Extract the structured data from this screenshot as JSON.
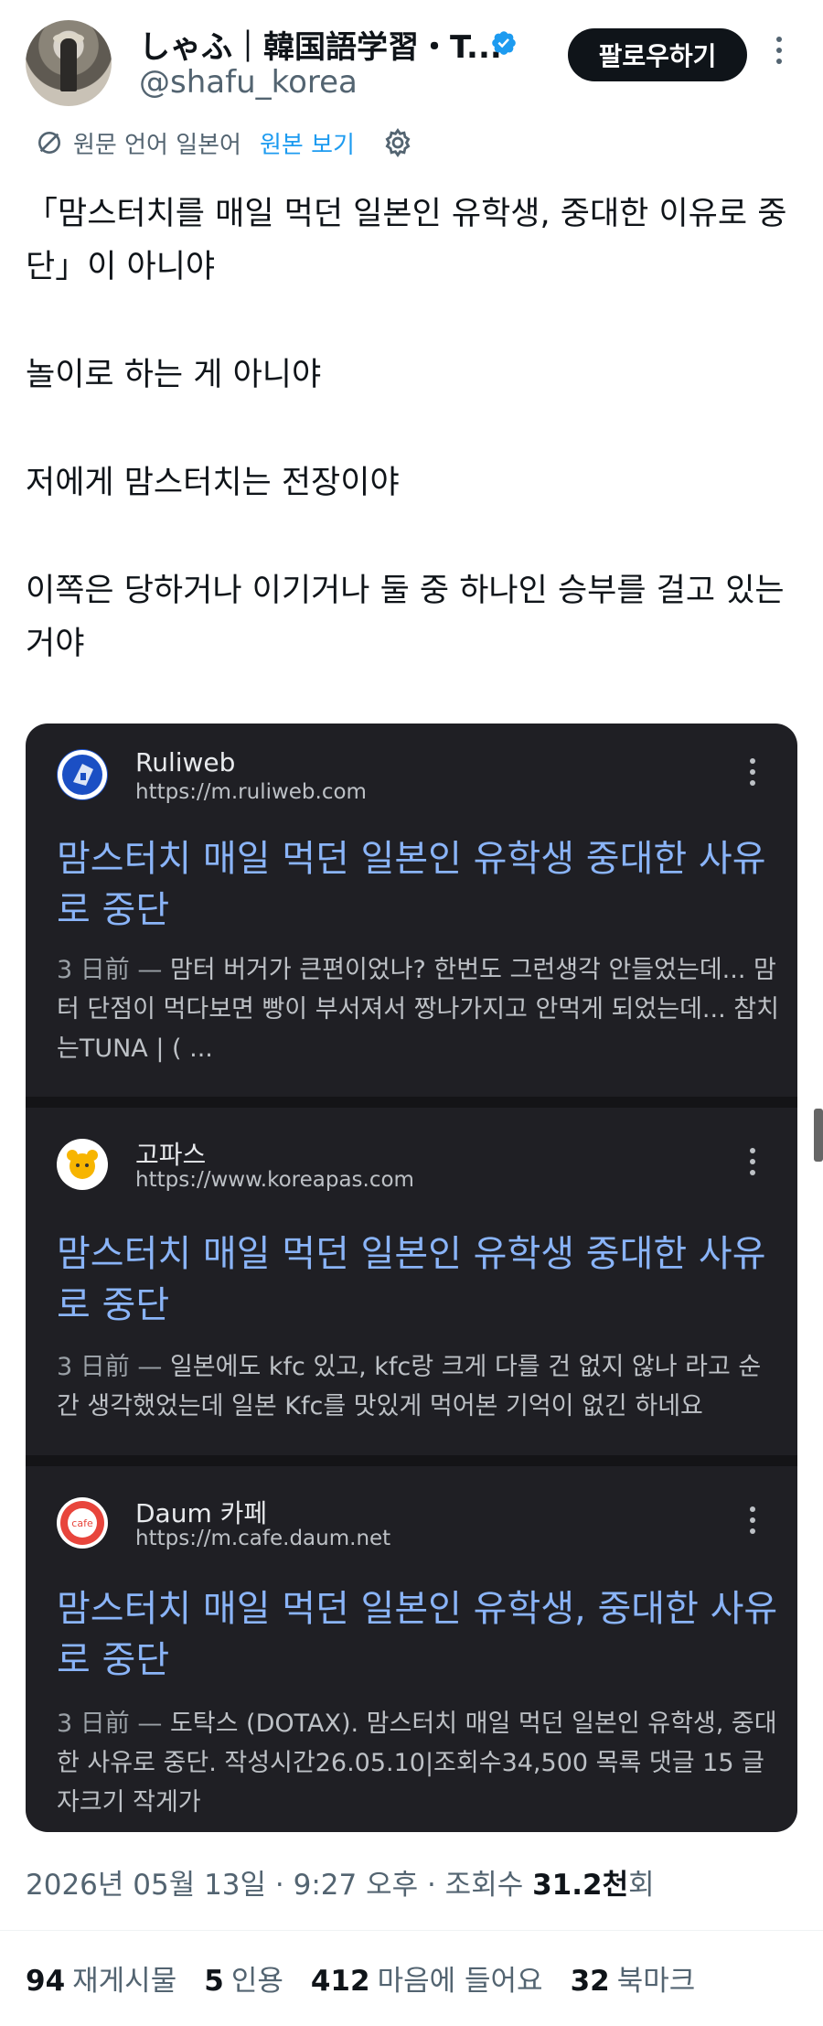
{
  "author": {
    "name": "しゃふ｜韓国語学習・T...",
    "handle": "@shafu_korea",
    "follow_label": "팔로우하기"
  },
  "translation": {
    "original_language": "원문 언어 일본어",
    "show_original": "원본 보기"
  },
  "tweet": {
    "lines": [
      "「맘스터치를 매일 먹던 일본인 유학생, 중대한 이유로 중단」이 아니야",
      "놀이로 하는 게 아니야",
      "저에게 맘스터치는 전장이야",
      "이쪽은 당하거나 이기거나 둘 중 하나인 승부를 걸고 있는 거야"
    ]
  },
  "results": [
    {
      "site": "Ruliweb",
      "url": "https://m.ruliweb.com",
      "title": "맘스터치 매일 먹던 일본인 유학생 중대한 사유로 중단",
      "date": "3 日前 — ",
      "snippet": "맘터 버거가 큰편이었나? 한번도 그런생각 안들었는데... 맘터 단점이 먹다보면 빵이 부서져서 짱나가지고 안먹게 되었는데... 참치는TUNA | ( ...",
      "logo_color": "#1b4fc4"
    },
    {
      "site": "고파스",
      "url": "https://www.koreapas.com",
      "title": "맘스터치 매일 먹던 일본인 유학생 중대한 사유로 중단",
      "date": "3 日前 — ",
      "snippet": "일본에도 kfc 있고, kfc랑 크게 다를 건 없지 않나 라고 순간 생각했었는데 일본 Kfc를 맛있게 먹어본 기억이 없긴 하네요",
      "logo_color": "#f7b500"
    },
    {
      "site": "Daum 카페",
      "url": "https://m.cafe.daum.net",
      "title": "맘스터치 매일 먹던 일본인 유학생, 중대한 사유로 중단",
      "date": "3 日前 — ",
      "snippet": "도탁스 (DOTAX). 맘스터치 매일 먹던 일본인 유학생, 중대한 사유로 중단. 작성시간26.05.10|조회수34,500 목록 댓글 15 글자크기 작게가",
      "logo_color": "#e8453c",
      "logo_text": "cafe"
    }
  ],
  "meta": {
    "timestamp": "2026년 05월 13일 · 9:27 오후 · 조회수 ",
    "views": "31.2천",
    "views_suffix": "회"
  },
  "stats": [
    {
      "count": "94",
      "label": "재게시물"
    },
    {
      "count": "5",
      "label": "인용"
    },
    {
      "count": "412",
      "label": "마음에 들어요"
    },
    {
      "count": "32",
      "label": "북마크"
    }
  ]
}
